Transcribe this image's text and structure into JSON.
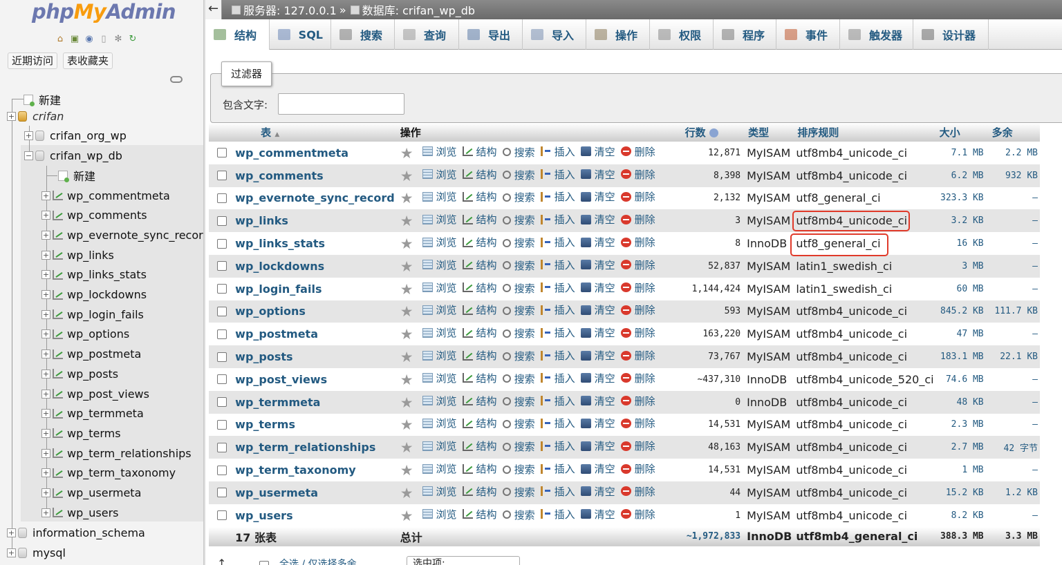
{
  "nav": {
    "logo": {
      "php": "php",
      "my": "My",
      "admin": "Admin"
    },
    "quick_icons": [
      "home-icon",
      "logout-icon",
      "help-icon",
      "docs-icon",
      "settings-icon",
      "reload-icon"
    ],
    "buttons": {
      "recent": "近期访问",
      "favorites": "表收藏夹"
    },
    "tree": {
      "new_server": "新建",
      "server_db": "crifan",
      "databases": [
        "crifan_org_wp",
        "crifan_wp_db"
      ],
      "new_table": "新建",
      "tables": [
        "wp_commentmeta",
        "wp_comments",
        "wp_evernote_sync_record",
        "wp_links",
        "wp_links_stats",
        "wp_lockdowns",
        "wp_login_fails",
        "wp_options",
        "wp_postmeta",
        "wp_posts",
        "wp_post_views",
        "wp_termmeta",
        "wp_terms",
        "wp_term_relationships",
        "wp_term_taxonomy",
        "wp_usermeta",
        "wp_users"
      ],
      "other_dbs": [
        "information_schema",
        "mysql"
      ]
    }
  },
  "breadcrumb": {
    "back": "←",
    "server": "服务器: 127.0.0.1",
    "separator": "»",
    "database": "数据库: crifan_wp_db"
  },
  "tabs": [
    {
      "label": "结构",
      "icon": "structure-icon"
    },
    {
      "label": "SQL",
      "icon": "sql-icon"
    },
    {
      "label": "搜索",
      "icon": "search-icon"
    },
    {
      "label": "查询",
      "icon": "query-icon"
    },
    {
      "label": "导出",
      "icon": "export-icon"
    },
    {
      "label": "导入",
      "icon": "import-icon"
    },
    {
      "label": "操作",
      "icon": "wrench-icon"
    },
    {
      "label": "权限",
      "icon": "privileges-icon"
    },
    {
      "label": "程序",
      "icon": "routines-icon"
    },
    {
      "label": "事件",
      "icon": "events-icon"
    },
    {
      "label": "触发器",
      "icon": "triggers-icon"
    },
    {
      "label": "设计器",
      "icon": "designer-icon"
    }
  ],
  "filter": {
    "legend": "过滤器",
    "label": "包含文字:",
    "value": ""
  },
  "table": {
    "headers": {
      "table": "表",
      "actions": "操作",
      "rows": "行数",
      "type": "类型",
      "collation": "排序规则",
      "size": "大小",
      "overhead": "多余"
    },
    "actions": {
      "browse": "浏览",
      "structure": "结构",
      "search": "搜索",
      "insert": "插入",
      "empty": "清空",
      "drop": "删除"
    },
    "rows": [
      {
        "name": "wp_commentmeta",
        "rows": "12,871",
        "type": "MyISAM",
        "collation": "utf8mb4_unicode_ci",
        "size": "7.1 MB",
        "overhead": "2.2 MB"
      },
      {
        "name": "wp_comments",
        "rows": "8,398",
        "type": "MyISAM",
        "collation": "utf8mb4_unicode_ci",
        "size": "6.2 MB",
        "overhead": "932 KB"
      },
      {
        "name": "wp_evernote_sync_record",
        "rows": "2,132",
        "type": "MyISAM",
        "collation": "utf8_general_ci",
        "size": "323.3 KB",
        "overhead": "–"
      },
      {
        "name": "wp_links",
        "rows": "3",
        "type": "MyISAM",
        "collation": "utf8mb4_unicode_ci",
        "size": "3.2 KB",
        "overhead": "–"
      },
      {
        "name": "wp_links_stats",
        "rows": "8",
        "type": "InnoDB",
        "collation": "utf8_general_ci",
        "size": "16 KB",
        "overhead": "–"
      },
      {
        "name": "wp_lockdowns",
        "rows": "52,837",
        "type": "MyISAM",
        "collation": "latin1_swedish_ci",
        "size": "3 MB",
        "overhead": "–"
      },
      {
        "name": "wp_login_fails",
        "rows": "1,144,424",
        "type": "MyISAM",
        "collation": "latin1_swedish_ci",
        "size": "60 MB",
        "overhead": "–"
      },
      {
        "name": "wp_options",
        "rows": "593",
        "type": "MyISAM",
        "collation": "utf8mb4_unicode_ci",
        "size": "845.2 KB",
        "overhead": "111.7 KB"
      },
      {
        "name": "wp_postmeta",
        "rows": "163,220",
        "type": "MyISAM",
        "collation": "utf8mb4_unicode_ci",
        "size": "47 MB",
        "overhead": "–"
      },
      {
        "name": "wp_posts",
        "rows": "73,767",
        "type": "MyISAM",
        "collation": "utf8mb4_unicode_ci",
        "size": "183.1 MB",
        "overhead": "22.1 KB"
      },
      {
        "name": "wp_post_views",
        "rows": "~437,310",
        "type": "InnoDB",
        "collation": "utf8mb4_unicode_520_ci",
        "size": "74.6 MB",
        "overhead": "–"
      },
      {
        "name": "wp_termmeta",
        "rows": "0",
        "type": "InnoDB",
        "collation": "utf8mb4_unicode_ci",
        "size": "48 KB",
        "overhead": "–"
      },
      {
        "name": "wp_terms",
        "rows": "14,531",
        "type": "MyISAM",
        "collation": "utf8mb4_unicode_ci",
        "size": "2.3 MB",
        "overhead": "–"
      },
      {
        "name": "wp_term_relationships",
        "rows": "48,163",
        "type": "MyISAM",
        "collation": "utf8mb4_unicode_ci",
        "size": "2.7 MB",
        "overhead": "42 字节"
      },
      {
        "name": "wp_term_taxonomy",
        "rows": "14,531",
        "type": "MyISAM",
        "collation": "utf8mb4_unicode_ci",
        "size": "1 MB",
        "overhead": "–"
      },
      {
        "name": "wp_usermeta",
        "rows": "44",
        "type": "MyISAM",
        "collation": "utf8mb4_unicode_ci",
        "size": "15.2 KB",
        "overhead": "1.2 KB"
      },
      {
        "name": "wp_users",
        "rows": "1",
        "type": "MyISAM",
        "collation": "utf8mb4_unicode_ci",
        "size": "8.2 KB",
        "overhead": "–"
      }
    ],
    "total": {
      "label": "17 张表",
      "sum_label": "总计",
      "rows": "~1,972,833",
      "type": "InnoDB",
      "collation": "utf8mb4_general_ci",
      "size": "388.3 MB",
      "overhead": "3.3 MB"
    }
  },
  "footer": {
    "arrow": "↑",
    "check_all": "全选 / 仅选择多余",
    "with_selected": "选中项:"
  },
  "colors": {
    "link": "#235a81",
    "highlight": "#e03a2a",
    "logo_blue": "#6c78af",
    "logo_orange": "#f89c0e"
  }
}
